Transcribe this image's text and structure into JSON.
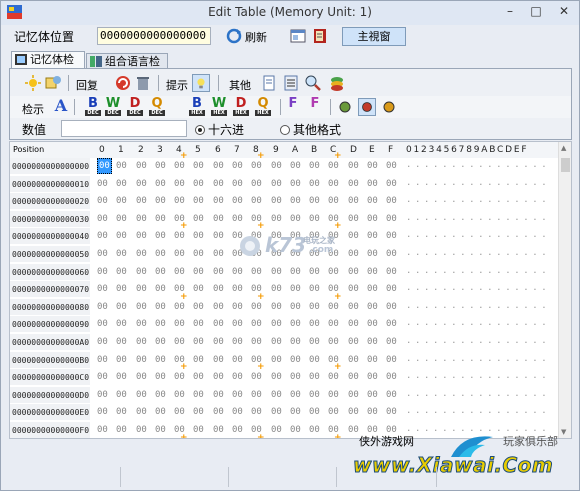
{
  "window": {
    "title": "Edit Table (Memory Unit: 1)",
    "minimize": "–",
    "maximize": "□",
    "close": "✕"
  },
  "top": {
    "address_label": "记忆体位置",
    "address_value": "0000000000000000",
    "refresh_label": "刷新",
    "main_window_label": "主視窗"
  },
  "tabs": [
    {
      "label": "记忆体检示"
    },
    {
      "label": "组合语言检示"
    }
  ],
  "toolbar": {
    "restore_label": "回复",
    "hint_label": "提示",
    "other_label": "其他",
    "search_label": "检示",
    "value_label": "数值",
    "value_input": "",
    "radio_hex": "十六进",
    "radio_other": "其他格式",
    "hex_buttons": [
      {
        "letter": "B",
        "sub": "DEC",
        "color": "#1a3fb8"
      },
      {
        "letter": "W",
        "sub": "DEC",
        "color": "#1d8f2b"
      },
      {
        "letter": "D",
        "sub": "DEC",
        "color": "#c02020"
      },
      {
        "letter": "Q",
        "sub": "DEC",
        "color": "#d48a00"
      },
      {
        "letter": "B",
        "sub": "HEX",
        "color": "#1a3fb8"
      },
      {
        "letter": "W",
        "sub": "HEX",
        "color": "#1d8f2b"
      },
      {
        "letter": "D",
        "sub": "HEX",
        "color": "#c02020"
      },
      {
        "letter": "Q",
        "sub": "HEX",
        "color": "#d48a00"
      }
    ]
  },
  "grid": {
    "position_header": "Position",
    "hex_headers": [
      "0",
      "1",
      "2",
      "3",
      "4",
      "5",
      "6",
      "7",
      "8",
      "9",
      "A",
      "B",
      "C",
      "D",
      "E",
      "F"
    ],
    "ascii_header": "0123456789ABCDEF",
    "rows": [
      {
        "pos": "0000000000000000",
        "ascii": "................"
      },
      {
        "pos": "0000000000000010",
        "ascii": "................"
      },
      {
        "pos": "0000000000000020",
        "ascii": "................"
      },
      {
        "pos": "0000000000000030",
        "ascii": "................"
      },
      {
        "pos": "0000000000000040",
        "ascii": "................"
      },
      {
        "pos": "0000000000000050",
        "ascii": "................"
      },
      {
        "pos": "0000000000000060",
        "ascii": "................"
      },
      {
        "pos": "0000000000000070",
        "ascii": "................"
      },
      {
        "pos": "0000000000000080",
        "ascii": "................"
      },
      {
        "pos": "0000000000000090",
        "ascii": "................"
      },
      {
        "pos": "00000000000000A0",
        "ascii": "................"
      },
      {
        "pos": "00000000000000B0",
        "ascii": "................"
      },
      {
        "pos": "00000000000000C0",
        "ascii": "................"
      },
      {
        "pos": "00000000000000D0",
        "ascii": "................"
      },
      {
        "pos": "00000000000000E0",
        "ascii": "................"
      },
      {
        "pos": "00000000000000F0",
        "ascii": "................"
      }
    ],
    "byte_value": "00",
    "selected_byte": "00"
  },
  "watermark": {
    "k73": "k73",
    "k73_sub": "电玩之家",
    "k73_url": ".com",
    "xiawai_cn": "侠外游戏网",
    "xiawai_en": "www.Xiawai.Com",
    "club": "玩家俱乐部"
  }
}
